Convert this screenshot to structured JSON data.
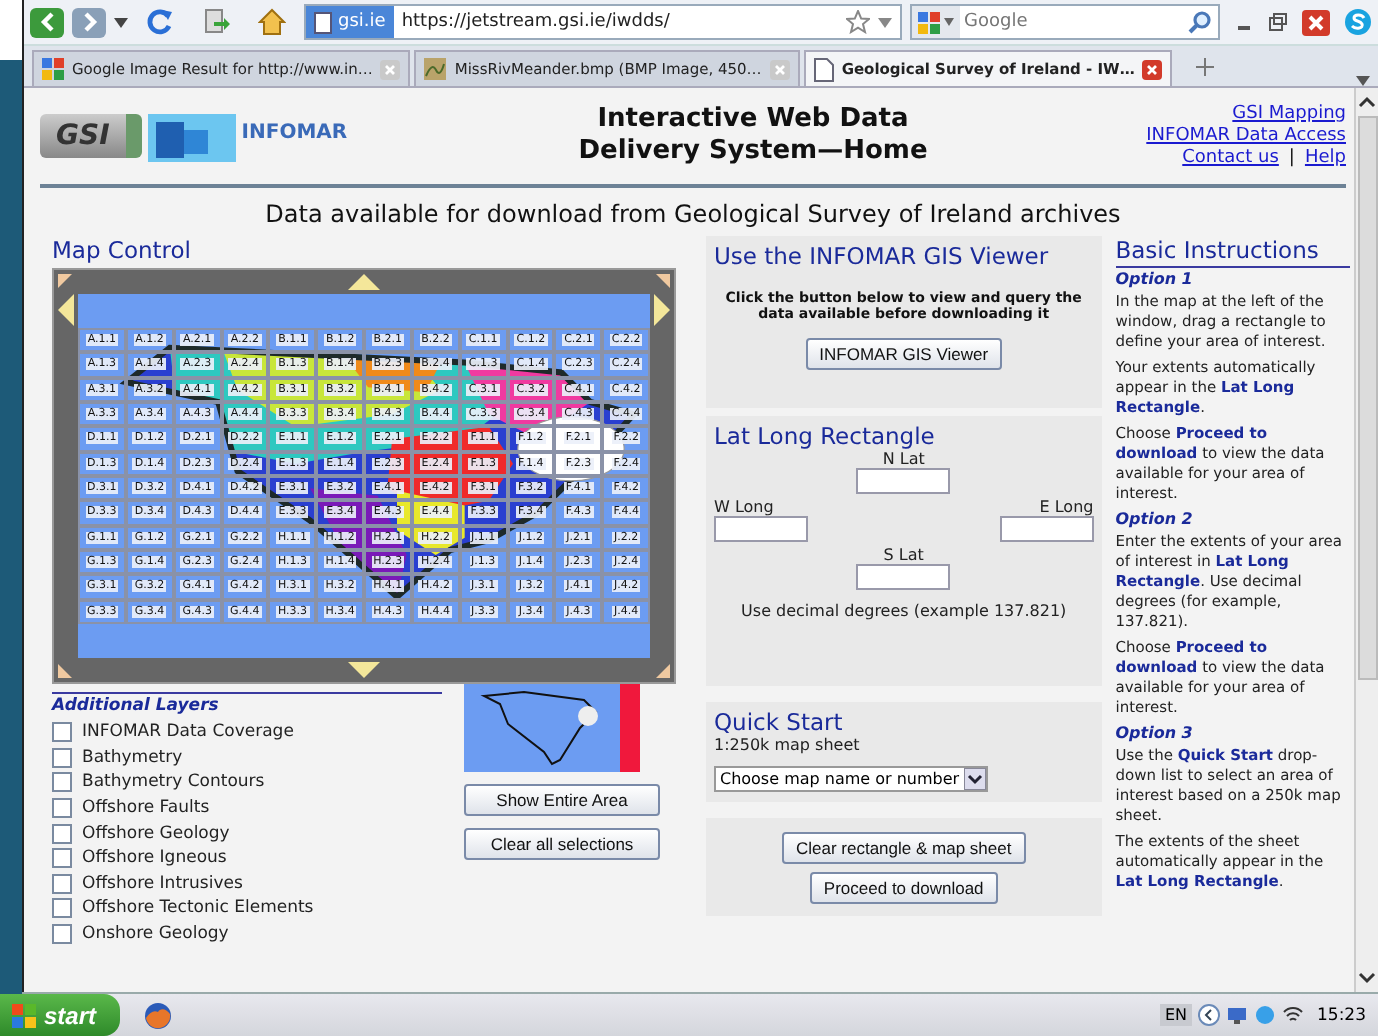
{
  "browser": {
    "site_badge": "gsi.ie",
    "url": "https://jetstream.gsi.ie/iwdds/",
    "search": {
      "placeholder": "Google"
    },
    "tabs": [
      {
        "label": "Google Image Result for http://www.in…",
        "kind": "google",
        "selected": false
      },
      {
        "label": "MissRivMeander.bmp (BMP Image, 450…",
        "kind": "image",
        "selected": false
      },
      {
        "label": "Geological Survey of Ireland - IW…",
        "kind": "page",
        "selected": true
      }
    ]
  },
  "header": {
    "gsi_logo": "GSI",
    "infomar_logo": "INFOMAR",
    "title_lines": [
      "Interactive Web Data",
      "Delivery System—Home"
    ],
    "links": [
      "GSI Mapping",
      "INFOMAR Data Access",
      "Contact us",
      "Help"
    ],
    "separator": "|"
  },
  "page_heading": "Data available for download from Geological Survey of Ireland archives",
  "map_control": {
    "title": "Map Control",
    "grid": [
      [
        "A.1.1",
        "A.1.2",
        "A.2.1",
        "A.2.2",
        "B.1.1",
        "B.1.2",
        "B.2.1",
        "B.2.2",
        "C.1.1",
        "C.1.2",
        "C.2.1",
        "C.2.2"
      ],
      [
        "A.1.3",
        "A.1.4",
        "A.2.3",
        "A.2.4",
        "B.1.3",
        "B.1.4",
        "B.2.3",
        "B.2.4",
        "C.1.3",
        "C.1.4",
        "C.2.3",
        "C.2.4"
      ],
      [
        "A.3.1",
        "A.3.2",
        "A.4.1",
        "A.4.2",
        "B.3.1",
        "B.3.2",
        "B.4.1",
        "B.4.2",
        "C.3.1",
        "C.3.2",
        "C.4.1",
        "C.4.2"
      ],
      [
        "A.3.3",
        "A.3.4",
        "A.4.3",
        "A.4.4",
        "B.3.3",
        "B.3.4",
        "B.4.3",
        "B.4.4",
        "C.3.3",
        "C.3.4",
        "C.4.3",
        "C.4.4"
      ],
      [
        "D.1.1",
        "D.1.2",
        "D.2.1",
        "D.2.2",
        "E.1.1",
        "E.1.2",
        "E.2.1",
        "E.2.2",
        "F.1.1",
        "F.1.2",
        "F.2.1",
        "F.2.2"
      ],
      [
        "D.1.3",
        "D.1.4",
        "D.2.3",
        "D.2.4",
        "E.1.3",
        "E.1.4",
        "E.2.3",
        "E.2.4",
        "F.1.3",
        "F.1.4",
        "F.2.3",
        "F.2.4"
      ],
      [
        "D.3.1",
        "D.3.2",
        "D.4.1",
        "D.4.2",
        "E.3.1",
        "E.3.2",
        "E.4.1",
        "E.4.2",
        "F.3.1",
        "F.3.2",
        "F.4.1",
        "F.4.2"
      ],
      [
        "D.3.3",
        "D.3.4",
        "D.4.3",
        "D.4.4",
        "E.3.3",
        "E.3.4",
        "E.4.3",
        "E.4.4",
        "F.3.3",
        "F.3.4",
        "F.4.3",
        "F.4.4"
      ],
      [
        "G.1.1",
        "G.1.2",
        "G.2.1",
        "G.2.2",
        "H.1.1",
        "H.1.2",
        "H.2.1",
        "H.2.2",
        "J.1.1",
        "J.1.2",
        "J.2.1",
        "J.2.2"
      ],
      [
        "G.1.3",
        "G.1.4",
        "G.2.3",
        "G.2.4",
        "H.1.3",
        "H.1.4",
        "H.2.3",
        "H.2.4",
        "J.1.3",
        "J.1.4",
        "J.2.3",
        "J.2.4"
      ],
      [
        "G.3.1",
        "G.3.2",
        "G.4.1",
        "G.4.2",
        "H.3.1",
        "H.3.2",
        "H.4.1",
        "H.4.2",
        "J.3.1",
        "J.3.2",
        "J.4.1",
        "J.4.2"
      ],
      [
        "G.3.3",
        "G.3.4",
        "G.4.3",
        "G.4.4",
        "H.3.3",
        "H.3.4",
        "H.4.3",
        "H.4.4",
        "J.3.3",
        "J.3.4",
        "J.4.3",
        "J.4.4"
      ]
    ]
  },
  "additional_layers": {
    "title": "Additional Layers",
    "items": [
      {
        "label": "INFOMAR Data Coverage",
        "checked": false
      },
      {
        "label": "Bathymetry",
        "checked": false
      },
      {
        "label": "Bathymetry Contours",
        "checked": false
      },
      {
        "label": "Offshore Faults",
        "checked": false
      },
      {
        "label": "Offshore Geology",
        "checked": false
      },
      {
        "label": "Offshore Igneous",
        "checked": false
      },
      {
        "label": "Offshore Intrusives",
        "checked": false
      },
      {
        "label": "Offshore Tectonic Elements",
        "checked": false
      },
      {
        "label": "Onshore Geology",
        "checked": false
      }
    ]
  },
  "map_buttons": [
    "Show Entire Area",
    "Clear all selections"
  ],
  "gis_viewer": {
    "title": "Use the INFOMAR GIS Viewer",
    "text": "Click the button below to view and query the data available before downloading it",
    "button": "INFOMAR GIS Viewer"
  },
  "lat_long": {
    "title": "Lat Long Rectangle",
    "n_lat": "N Lat",
    "w_long": "W Long",
    "e_long": "E Long",
    "s_lat": "S Lat",
    "note": "Use decimal degrees (example 137.821)"
  },
  "quick_start": {
    "title": "Quick Start",
    "label": "1:250k map sheet",
    "select_value": "Choose map name or number"
  },
  "actions": [
    "Clear rectangle & map sheet",
    "Proceed to download"
  ],
  "instructions": {
    "title": "Basic Instructions",
    "options": [
      {
        "heading": "Option 1",
        "paragraphs": [
          "In the map at the left of the window, drag a rectangle to define your area of interest.",
          "Your extents automatically appear in the **Lat Long Rectangle**.",
          "Choose **Proceed to download** to view the data available for your area of interest."
        ]
      },
      {
        "heading": "Option 2",
        "paragraphs": [
          "Enter the extents of your area of interest in **Lat Long Rectangle**. Use decimal degrees (for example, 137.821).",
          "Choose **Proceed to download** to view the data available for your area of interest."
        ]
      },
      {
        "heading": "Option 3",
        "paragraphs": [
          "Use the **Quick Start** drop-down list to select an area of interest based on a 250k map sheet.",
          "The extents of the sheet automatically appear in the **Lat Long Rectangle**."
        ]
      }
    ]
  },
  "taskbar": {
    "start": "start",
    "language": "EN",
    "clock": "15:23"
  }
}
